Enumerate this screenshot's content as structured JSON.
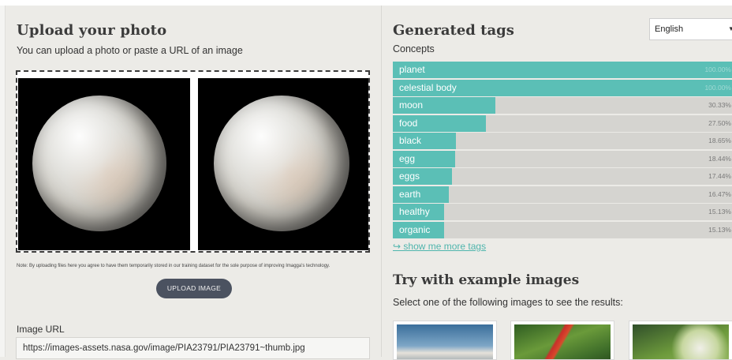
{
  "upload": {
    "title": "Upload your photo",
    "subtitle": "You can upload a photo or paste a URL of an image",
    "note": "Note: By uploading files here you agree to have them temporarily stored in our training dataset for the sole purpose of improving Imagga's technology.",
    "button_label": "UPLOAD IMAGE",
    "url_label": "Image URL",
    "url_value": "https://images-assets.nasa.gov/image/PIA23791/PIA23791~thumb.jpg"
  },
  "results": {
    "title": "Generated tags",
    "language": "English",
    "concepts_label": "Concepts",
    "tags": [
      {
        "name": "planet",
        "confidence": 100.0,
        "label": "100.00%"
      },
      {
        "name": "celestial body",
        "confidence": 100.0,
        "label": "100.00%"
      },
      {
        "name": "moon",
        "confidence": 30.33,
        "label": "30.33%"
      },
      {
        "name": "food",
        "confidence": 27.5,
        "label": "27.50%"
      },
      {
        "name": "black",
        "confidence": 18.65,
        "label": "18.65%"
      },
      {
        "name": "egg",
        "confidence": 18.44,
        "label": "18.44%"
      },
      {
        "name": "eggs",
        "confidence": 17.44,
        "label": "17.44%"
      },
      {
        "name": "earth",
        "confidence": 16.47,
        "label": "16.47%"
      },
      {
        "name": "healthy",
        "confidence": 15.13,
        "label": "15.13%"
      },
      {
        "name": "organic",
        "confidence": 15.13,
        "label": "15.13%"
      }
    ],
    "more_link": "↪ show me more tags"
  },
  "examples": {
    "title": "Try with example images",
    "subtitle": "Select one of the following images to see the results:"
  },
  "colors": {
    "accent": "#5bbfb6",
    "bar_background": "#d5d4d0",
    "button": "#4b5260",
    "page_background": "#ecebe7"
  }
}
